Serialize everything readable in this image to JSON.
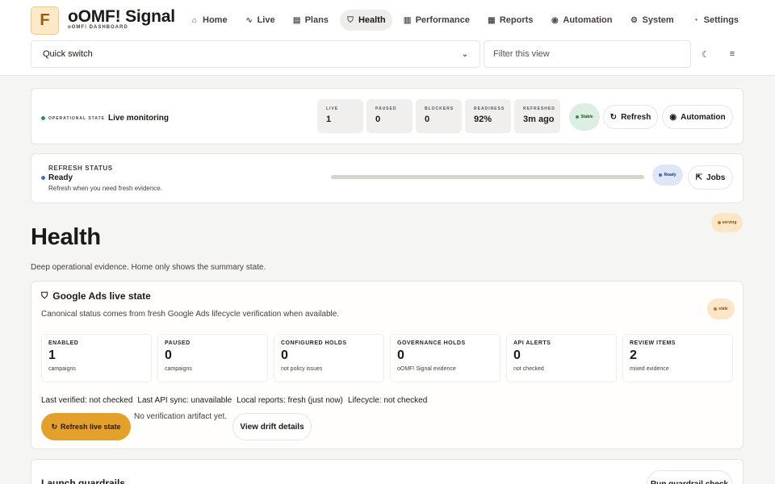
{
  "brand": {
    "logo_letter": "F",
    "name": "oOMF! Signal",
    "tagline": "oOMF! DASHBOARD"
  },
  "nav": [
    {
      "label": "Home",
      "icon": "home-icon",
      "glyph": "⌂",
      "active": false
    },
    {
      "label": "Live",
      "icon": "pulse-icon",
      "glyph": "∿",
      "active": false
    },
    {
      "label": "Plans",
      "icon": "clipboard-icon",
      "glyph": "▤",
      "active": false
    },
    {
      "label": "Health",
      "icon": "shield-check-icon",
      "glyph": "⛉",
      "active": true
    },
    {
      "label": "Performance",
      "icon": "bar-chart-icon",
      "glyph": "▥",
      "active": false
    },
    {
      "label": "Reports",
      "icon": "report-icon",
      "glyph": "▦",
      "active": false
    },
    {
      "label": "Automation",
      "icon": "play-circle-icon",
      "glyph": "◉",
      "active": false
    },
    {
      "label": "System",
      "icon": "gear-icon",
      "glyph": "⚙",
      "active": false
    },
    {
      "label": "Settings",
      "icon": "gauge-icon",
      "glyph": "◔",
      "active": false
    }
  ],
  "toolbar": {
    "quick_switch": "Quick switch",
    "filter_placeholder": "Filter this view",
    "theme_icon": "moon-icon",
    "menu_icon": "hamburger-menu-icon"
  },
  "status": {
    "op_label": "OPERATIONAL STATE",
    "op_value": "Live monitoring",
    "stats": [
      {
        "key": "LIVE",
        "value": "1"
      },
      {
        "key": "PAUSED",
        "value": "0"
      },
      {
        "key": "BLOCKERS",
        "value": "0"
      },
      {
        "key": "READINESS",
        "value": "92%"
      },
      {
        "key": "REFRESHED",
        "value": "3m ago"
      }
    ],
    "badge": "Stable",
    "refresh_label": "Refresh",
    "automation_label": "Automation"
  },
  "refresh_status": {
    "heading": "REFRESH STATUS",
    "state": "Ready",
    "note": "Refresh when you need fresh evidence.",
    "progress": 1.0,
    "badge": "Ready",
    "jobs_label": "Jobs"
  },
  "page": {
    "badge": "serving",
    "title": "Health",
    "subtitle": "Deep operational evidence. Home only shows the summary state."
  },
  "google_ads": {
    "title": "Google Ads live state",
    "description": "Canonical status comes from fresh Google Ads lifecycle verification when available.",
    "badge": "stale",
    "metrics": [
      {
        "key": "ENABLED",
        "value": "1",
        "sub": "campaigns"
      },
      {
        "key": "PAUSED",
        "value": "0",
        "sub": "campaigns"
      },
      {
        "key": "CONFIGURED HOLDS",
        "value": "0",
        "sub": "not policy issues"
      },
      {
        "key": "GOVERNANCE HOLDS",
        "value": "0",
        "sub": "oOMF! Signal evidence"
      },
      {
        "key": "API ALERTS",
        "value": "0",
        "sub": "not checked"
      },
      {
        "key": "REVIEW ITEMS",
        "value": "2",
        "sub": "mixed evidence"
      }
    ],
    "meta": [
      "Last verified: not checked",
      "Last API sync: unavailable",
      "Local reports: fresh (just now)",
      "Lifecycle: not checked"
    ],
    "refresh_button": "Refresh live state",
    "no_artifact": "No verification artifact yet.",
    "drift_button": "View drift details"
  },
  "guardrails": {
    "title": "Launch guardrails",
    "button": "Run guardrail check"
  },
  "colors": {
    "accent_orange": "#e3a12b",
    "ok_green": "#2f8f55",
    "info_blue": "#3b6fd0",
    "warn_amber": "#c9770f"
  }
}
